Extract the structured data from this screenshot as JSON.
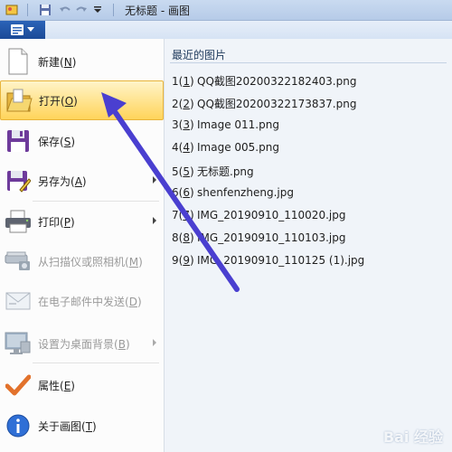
{
  "window": {
    "title": "无标题 - 画图"
  },
  "quick_access": {
    "icons": [
      "save-icon",
      "undo-icon",
      "redo-icon",
      "customize-icon"
    ]
  },
  "app_menu": {
    "items": [
      {
        "label": "新建",
        "key": "N",
        "icon": "new-file-icon",
        "enabled": true,
        "submenu": false
      },
      {
        "label": "打开",
        "key": "O",
        "icon": "open-folder-icon",
        "enabled": true,
        "submenu": false,
        "highlighted": true
      },
      {
        "label": "保存",
        "key": "S",
        "icon": "save-disk-icon",
        "enabled": true,
        "submenu": false
      },
      {
        "label": "另存为",
        "key": "A",
        "icon": "save-as-icon",
        "enabled": true,
        "submenu": true
      },
      {
        "label": "打印",
        "key": "P",
        "icon": "printer-icon",
        "enabled": true,
        "submenu": true
      },
      {
        "label": "从扫描仪或照相机",
        "key": "M",
        "icon": "scanner-icon",
        "enabled": false,
        "submenu": false
      },
      {
        "label": "在电子邮件中发送",
        "key": "D",
        "icon": "email-icon",
        "enabled": false,
        "submenu": false
      },
      {
        "label": "设置为桌面背景",
        "key": "B",
        "icon": "desktop-background-icon",
        "enabled": false,
        "submenu": true
      },
      {
        "label": "属性",
        "key": "E",
        "icon": "checkmark-icon",
        "enabled": true,
        "submenu": false
      },
      {
        "label": "关于画图",
        "key": "T",
        "icon": "info-icon",
        "enabled": true,
        "submenu": false
      }
    ]
  },
  "recent": {
    "title": "最近的图片",
    "items": [
      {
        "n": "1",
        "name": "QQ截图20200322182403.png"
      },
      {
        "n": "2",
        "name": "QQ截图20200322173837.png"
      },
      {
        "n": "3",
        "name": "Image 011.png"
      },
      {
        "n": "4",
        "name": "Image 005.png"
      },
      {
        "n": "5",
        "name": "无标题.png"
      },
      {
        "n": "6",
        "name": "shenfenzheng.jpg"
      },
      {
        "n": "7",
        "name": "IMG_20190910_110020.jpg"
      },
      {
        "n": "8",
        "name": "IMG_20190910_110103.jpg"
      },
      {
        "n": "9",
        "name": "IMG_20190910_110125 (1).jpg"
      }
    ]
  },
  "annotation": {
    "arrow_color": "#4a3fd0"
  },
  "watermark": {
    "text": "Bai 经验"
  }
}
